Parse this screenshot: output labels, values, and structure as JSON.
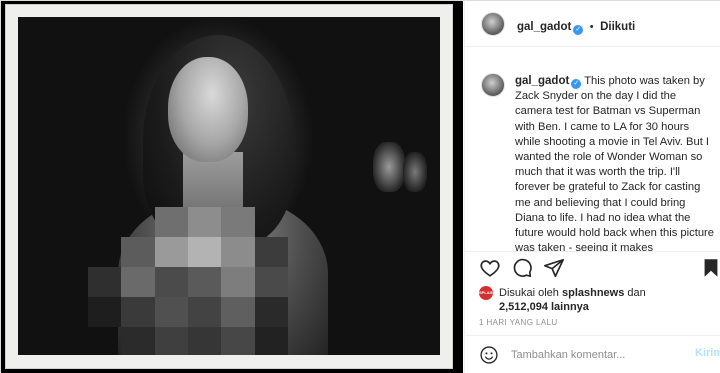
{
  "header": {
    "username": "gal_gadot",
    "separator": "•",
    "follow_status": "Diikuti"
  },
  "caption": {
    "username": "gal_gadot",
    "text": "This photo was taken by Zack Snyder on the day I did the camera test for Batman vs Superman with Ben. I came to LA for 30 hours while shooting a movie in Tel Aviv. But I wanted the role of Wonder Woman so much that it was worth the trip. I'll forever be grateful to Zack for casting me and believing that I could bring Diana to life. I had no idea what the future would hold back when this picture was taken - seeing it makes"
  },
  "likes": {
    "prefix": "Disukai oleh",
    "user": "splashnews",
    "conjunction": "dan",
    "count": "2,512,094",
    "suffix": "lainnya",
    "avatar_label": "SPLASH"
  },
  "timestamp": "1 HARI YANG LALU",
  "comment": {
    "placeholder": "Tambahkan komentar...",
    "post_label": "Kirim"
  },
  "icons": {
    "like": "heart-icon",
    "comment": "comment-icon",
    "share": "share-icon",
    "save": "bookmark-icon",
    "emoji": "emoji-icon",
    "verified": "verified-badge-icon"
  },
  "colors": {
    "verified": "#3897f0",
    "post_button": "#b2dffc",
    "muted": "#8e8e8e"
  }
}
